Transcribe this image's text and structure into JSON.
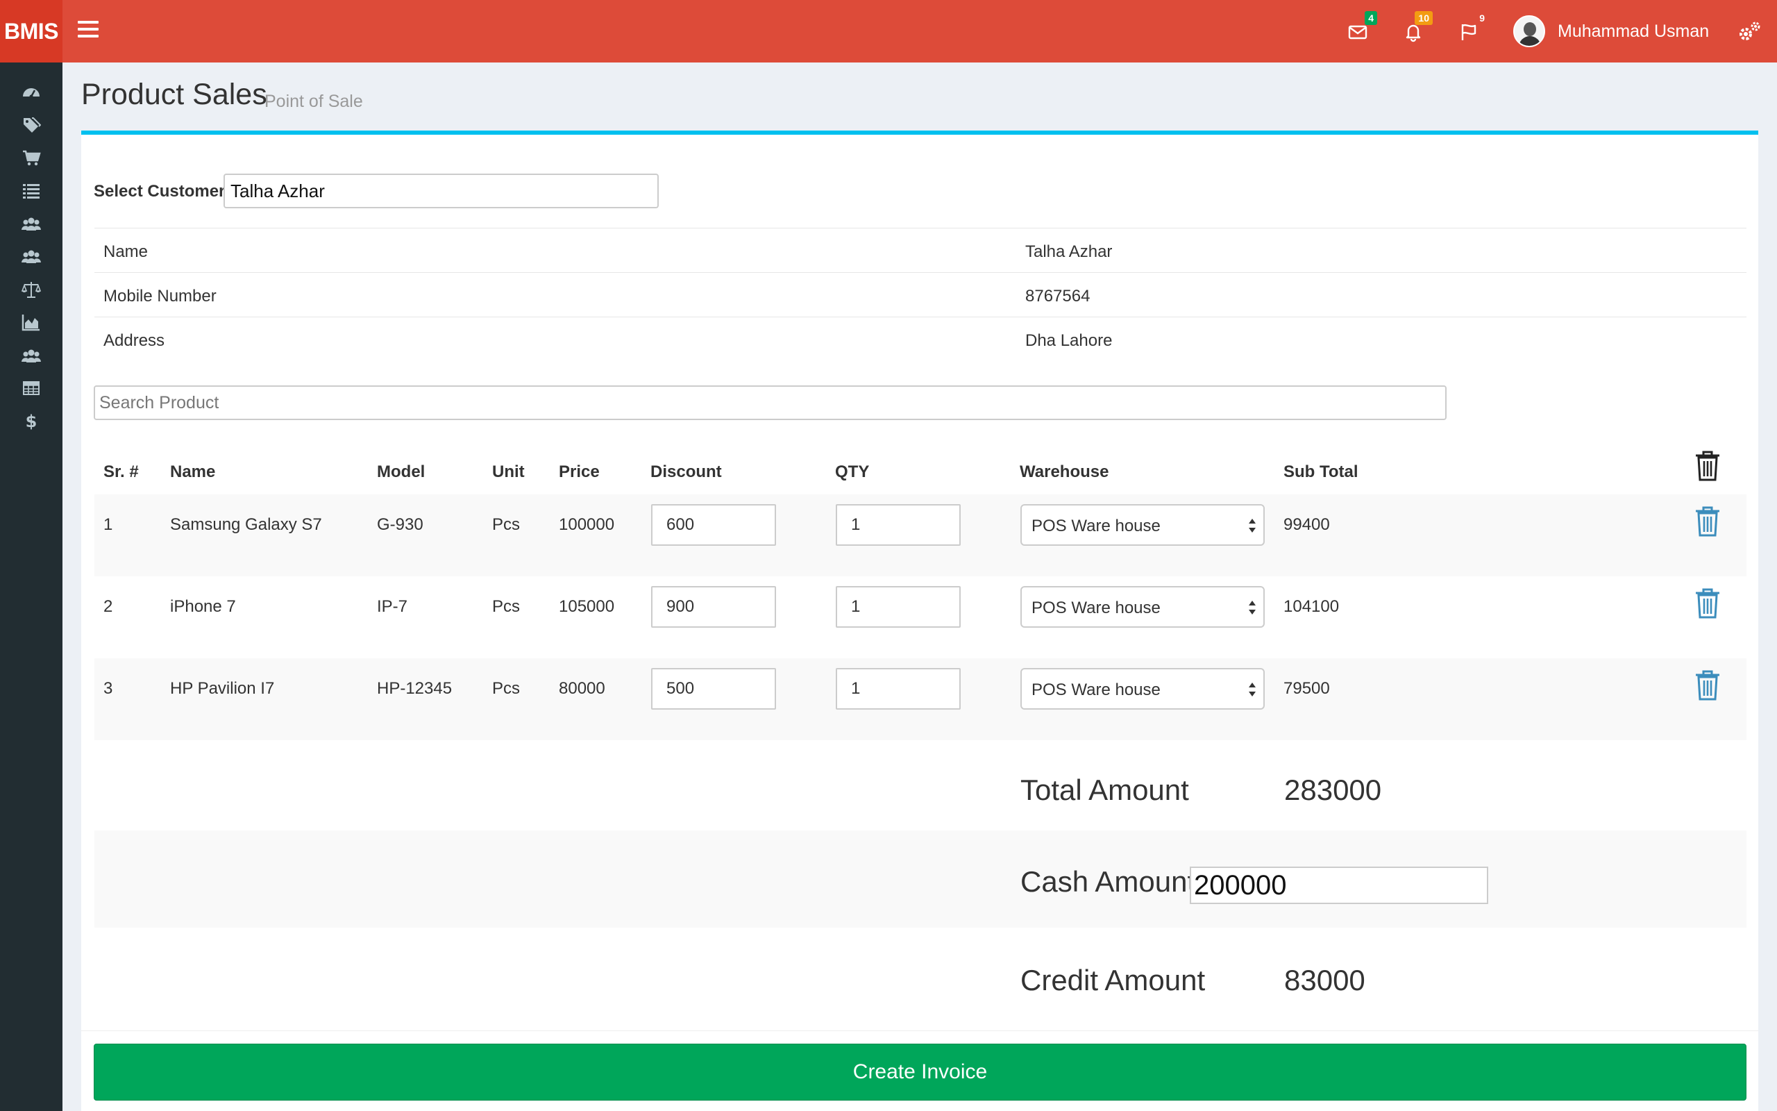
{
  "app": {
    "brand": "BMIS"
  },
  "header": {
    "badges": {
      "messages": "4",
      "notifications": "10",
      "tasks": "9"
    },
    "user_name": "Muhammad Usman"
  },
  "sidebar": {
    "icons": [
      "dashboard-icon",
      "tags-icon",
      "cart-icon",
      "list-icon",
      "users-icon",
      "users-icon",
      "balance-scale-icon",
      "area-chart-icon",
      "users-icon",
      "table-icon",
      "dollar-icon"
    ]
  },
  "page": {
    "title": "Product Sales",
    "subtitle": "Point of Sale"
  },
  "customer": {
    "label": "Select Customer",
    "value": "Talha Azhar",
    "details": [
      {
        "key": "Name",
        "value": "Talha Azhar"
      },
      {
        "key": "Mobile Number",
        "value": "8767564"
      },
      {
        "key": "Address",
        "value": "Dha Lahore"
      }
    ]
  },
  "search": {
    "placeholder": "Search Product"
  },
  "table": {
    "headers": {
      "sr": "Sr. #",
      "name": "Name",
      "model": "Model",
      "unit": "Unit",
      "price": "Price",
      "discount": "Discount",
      "qty": "QTY",
      "warehouse": "Warehouse",
      "subtotal": "Sub Total"
    },
    "rows": [
      {
        "sr": "1",
        "name": "Samsung Galaxy S7",
        "model": "G-930",
        "unit": "Pcs",
        "price": "100000",
        "discount": "600",
        "qty": "1",
        "warehouse": "POS Ware house",
        "subtotal": "99400"
      },
      {
        "sr": "2",
        "name": "iPhone 7",
        "model": "IP-7",
        "unit": "Pcs",
        "price": "105000",
        "discount": "900",
        "qty": "1",
        "warehouse": "POS Ware house",
        "subtotal": "104100"
      },
      {
        "sr": "3",
        "name": "HP Pavilion I7",
        "model": "HP-12345",
        "unit": "Pcs",
        "price": "80000",
        "discount": "500",
        "qty": "1",
        "warehouse": "POS Ware house",
        "subtotal": "79500"
      }
    ]
  },
  "totals": {
    "total_label": "Total Amount",
    "total_value": "283000",
    "cash_label": "Cash Amount",
    "cash_value": "200000",
    "credit_label": "Credit Amount",
    "credit_value": "83000"
  },
  "actions": {
    "create_invoice": "Create Invoice"
  },
  "colors": {
    "header": "#dd4b39",
    "sidebar": "#222d32",
    "accent": "#00c0ef",
    "success": "#00a65a",
    "trash_blue": "#3c8dbc"
  }
}
